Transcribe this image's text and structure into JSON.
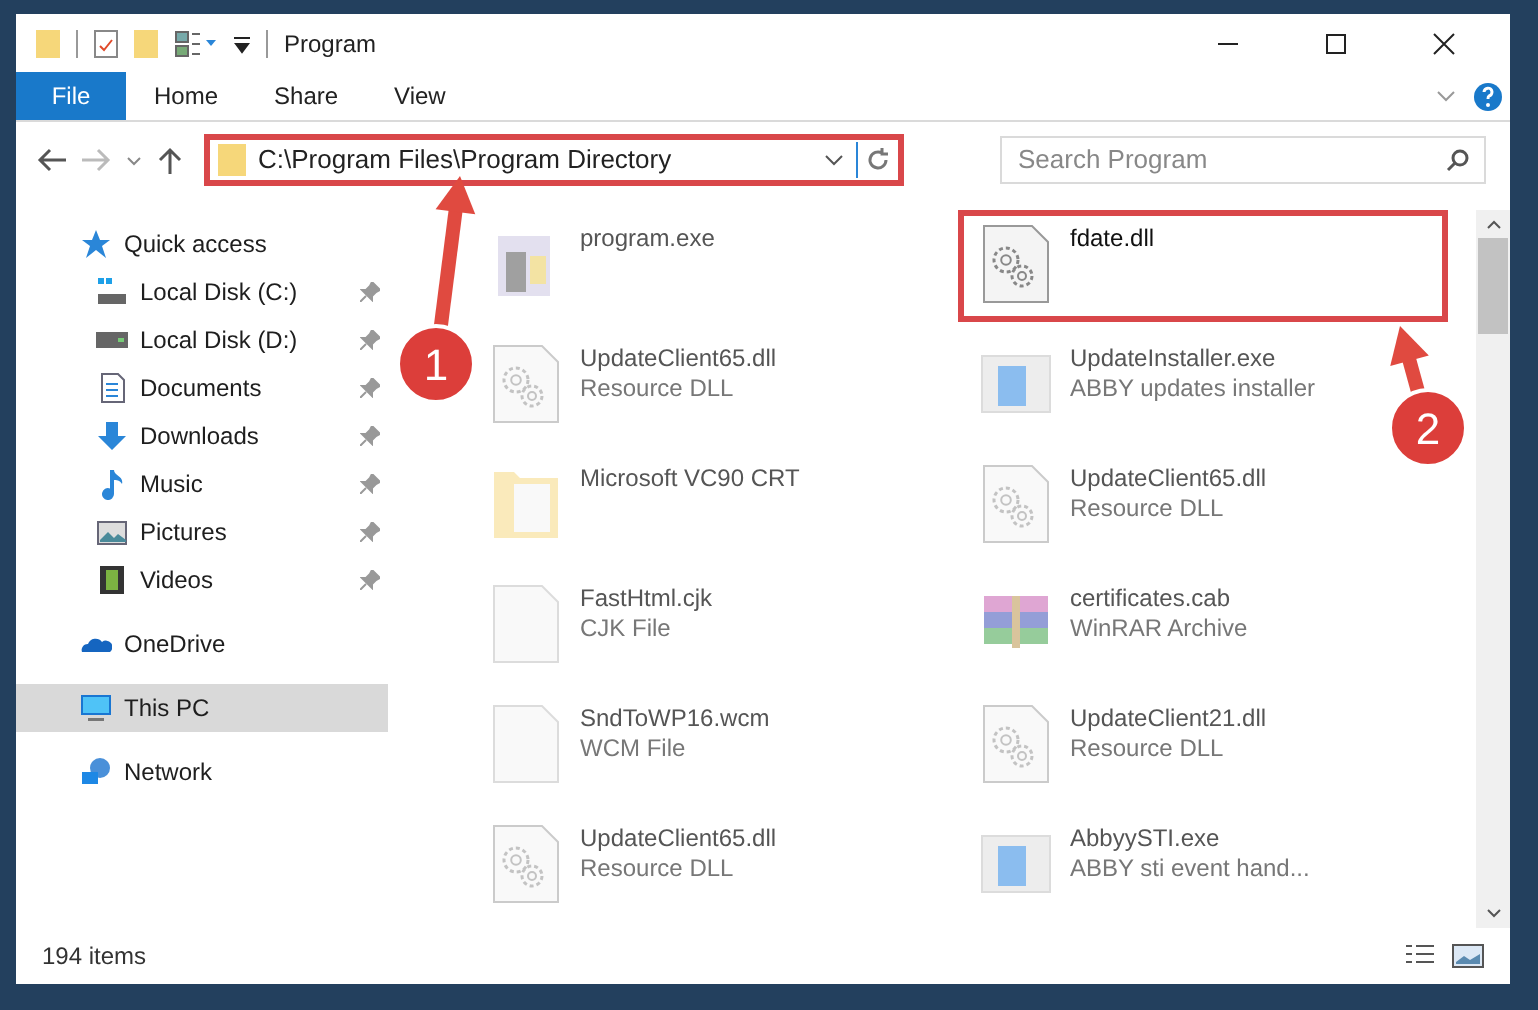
{
  "window": {
    "title": "Program"
  },
  "ribbon_tabs": [
    {
      "label": "File",
      "selected": true
    },
    {
      "label": "Home",
      "selected": false
    },
    {
      "label": "Share",
      "selected": false
    },
    {
      "label": "View",
      "selected": false
    }
  ],
  "address": {
    "path": "C:\\Program Files\\Program Directory",
    "highlighted": true
  },
  "search": {
    "placeholder": "Search Program"
  },
  "sidebar": {
    "items": [
      {
        "label": "Quick access",
        "kind": "quick",
        "pinned": false,
        "selected": false,
        "children": [
          {
            "label": "Local Disk (C:)",
            "kind": "disk-c",
            "pinned": true,
            "selected": false
          },
          {
            "label": "Local Disk (D:)",
            "kind": "disk",
            "pinned": true,
            "selected": false
          },
          {
            "label": "Documents",
            "kind": "documents",
            "pinned": true,
            "selected": false
          },
          {
            "label": "Downloads",
            "kind": "downloads",
            "pinned": true,
            "selected": false
          },
          {
            "label": "Music",
            "kind": "music",
            "pinned": true,
            "selected": false
          },
          {
            "label": "Pictures",
            "kind": "pictures",
            "pinned": true,
            "selected": false
          },
          {
            "label": "Videos",
            "kind": "videos",
            "pinned": true,
            "selected": false
          }
        ]
      },
      {
        "label": "OneDrive",
        "kind": "cloud",
        "pinned": false,
        "selected": false
      },
      {
        "label": "This PC",
        "kind": "pc",
        "pinned": false,
        "selected": true
      },
      {
        "label": "Network",
        "kind": "network",
        "pinned": false,
        "selected": false
      }
    ]
  },
  "files": [
    {
      "name": "program.exe",
      "kind": "app",
      "highlighted": false
    },
    {
      "name": "fdate.dll",
      "kind": "dll",
      "highlighted": true
    },
    {
      "name": "UpdateClient65.dll",
      "type": "Resource DLL",
      "kind": "dll",
      "highlighted": false
    },
    {
      "name": "UpdateInstaller.exe",
      "type": "ABBY updates installer",
      "kind": "installer",
      "highlighted": false
    },
    {
      "name": "Microsoft VC90 CRT",
      "kind": "folder",
      "highlighted": false
    },
    {
      "name": "UpdateClient65.dll",
      "type": "Resource DLL",
      "kind": "dll",
      "highlighted": false
    },
    {
      "name": "FastHtml.cjk",
      "type": "CJK File",
      "kind": "file",
      "highlighted": false
    },
    {
      "name": "certificates.cab",
      "type": "WinRAR Archive",
      "kind": "archive",
      "highlighted": false
    },
    {
      "name": "SndToWP16.wcm",
      "type": "WCM File",
      "kind": "file",
      "highlighted": false
    },
    {
      "name": "UpdateClient21.dll",
      "type": "Resource DLL",
      "kind": "dll",
      "highlighted": false
    },
    {
      "name": "UpdateClient65.dll",
      "type": "Resource DLL",
      "kind": "dll",
      "highlighted": false
    },
    {
      "name": "AbbyySTI.exe",
      "type": "ABBY sti event hand...",
      "kind": "installer",
      "highlighted": false
    }
  ],
  "status_bar": {
    "count": "194 items"
  },
  "annotations": [
    {
      "number": "1"
    },
    {
      "number": "2"
    }
  ]
}
